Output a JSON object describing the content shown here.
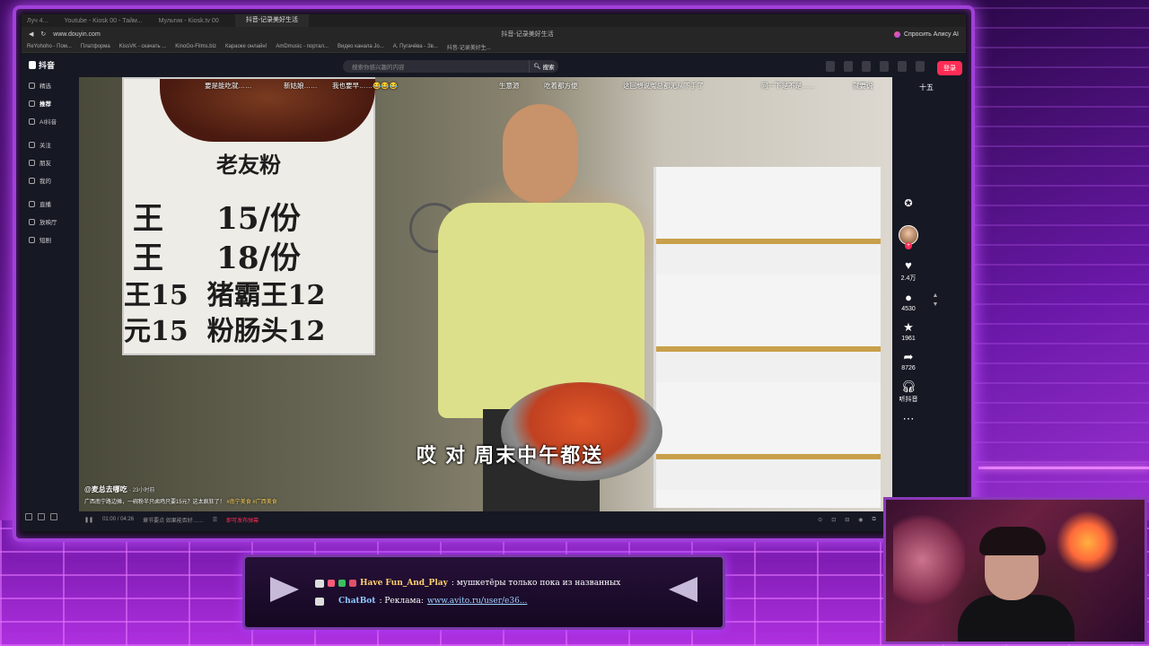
{
  "browser": {
    "tabs": [
      "Луч 4...",
      "Youtube - Kiosk 00 - Тайм...",
      "Мультик - Kiosk.tv 00",
      "抖音-记录美好生活"
    ],
    "url": "www.douyin.com",
    "title": "抖音-记录美好生活",
    "alice_label": "Спросить Алису AI",
    "bookmarks": [
      "ReYohoho - Пом...",
      "Платформа",
      "KissVK - скачать ...",
      "KinoGo-Films.biz",
      "Караоке онлайн!",
      "AmDmusic - портал...",
      "Видео канала Jo...",
      "А. Пугачёва - Зв...",
      "抖音-记录美好生..."
    ]
  },
  "app": {
    "logo": "抖音",
    "nav": [
      {
        "label": "精选",
        "active": false
      },
      {
        "label": "推荐",
        "active": true
      },
      {
        "label": "AI抖音",
        "active": false
      },
      {
        "label": "关注",
        "active": false
      },
      {
        "label": "朋友",
        "active": false
      },
      {
        "label": "我的",
        "active": false
      },
      {
        "label": "直播",
        "active": false
      },
      {
        "label": "放映厅",
        "active": false
      },
      {
        "label": "短剧",
        "active": false
      }
    ],
    "search_placeholder": "搜索你感兴趣的内容",
    "search_button": "搜索",
    "login": "登录"
  },
  "video": {
    "episode": "十五",
    "bullet_comments": [
      "要是能吃就……",
      "新姑娘……",
      "我也要早……😂😂😂",
      "生意源",
      "吃着都方便",
      "这回想说冤总都无从下手了",
      "问一下是不是……",
      "就要说"
    ],
    "sign_lines": [
      "老友粉",
      "王     15/份",
      "王     18/份",
      "王15  猪霸王12",
      "元15  粉肠头12"
    ],
    "subtitle": "哎 对 周末中午都送",
    "author": "@麦总去哪吃",
    "time": "· 23小时前",
    "caption": "广西南宁路边摊，一碗粉半只卤鸡只要15元？这太疯狂了！",
    "tags": [
      "#南宁美食",
      "#广西美食"
    ],
    "stats": {
      "likes": "2.4万",
      "comments": "4530",
      "favorites": "1961",
      "shares": "8726",
      "listen": "听抖音"
    },
    "controls": {
      "time": "01:00 / 04:26",
      "chapter": "章节要点  如果能否好……",
      "publish": "发布弹幕",
      "publish_hint": "即可发布弹幕"
    }
  },
  "chat": {
    "messages": [
      {
        "user": "Have Fun_And_Play",
        "text": ": мушкетёры только пока из названных"
      },
      {
        "user": "ChatBot",
        "text": ": Реклама: ",
        "link": "www.avito.ru/user/e36..."
      }
    ]
  },
  "colors": {
    "accent": "#fe2c55",
    "neon": "#c050ff"
  }
}
